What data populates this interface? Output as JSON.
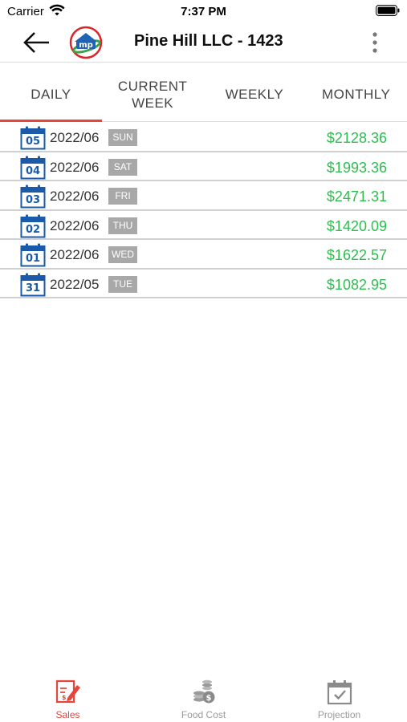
{
  "status_bar": {
    "carrier": "Carrier",
    "time": "7:37 PM"
  },
  "header": {
    "title": "Pine Hill LLC - 1423",
    "logo_text": "mp"
  },
  "tabs": [
    {
      "label": "DAILY",
      "active": true
    },
    {
      "label": "CURRENT\nWEEK",
      "active": false
    },
    {
      "label": "WEEKLY",
      "active": false
    },
    {
      "label": "MONTHLY",
      "active": false
    }
  ],
  "rows": [
    {
      "day": "05",
      "month": "2022/06",
      "dow": "SUN",
      "amount": "$2128.36"
    },
    {
      "day": "04",
      "month": "2022/06",
      "dow": "SAT",
      "amount": "$1993.36"
    },
    {
      "day": "03",
      "month": "2022/06",
      "dow": "FRI",
      "amount": "$2471.31"
    },
    {
      "day": "02",
      "month": "2022/06",
      "dow": "THU",
      "amount": "$1420.09"
    },
    {
      "day": "01",
      "month": "2022/06",
      "dow": "WED",
      "amount": "$1622.57"
    },
    {
      "day": "31",
      "month": "2022/05",
      "dow": "TUE",
      "amount": "$1082.95"
    }
  ],
  "bottom_nav": [
    {
      "label": "Sales",
      "icon": "sales-icon",
      "active": true
    },
    {
      "label": "Food Cost",
      "icon": "food-cost-icon",
      "active": false
    },
    {
      "label": "Projection",
      "icon": "projection-icon",
      "active": false
    }
  ],
  "colors": {
    "accent": "#e6453b",
    "amount_green": "#2dbe4f",
    "calendar_blue": "#1a5aa8",
    "dow_badge": "#a8a8a8"
  }
}
